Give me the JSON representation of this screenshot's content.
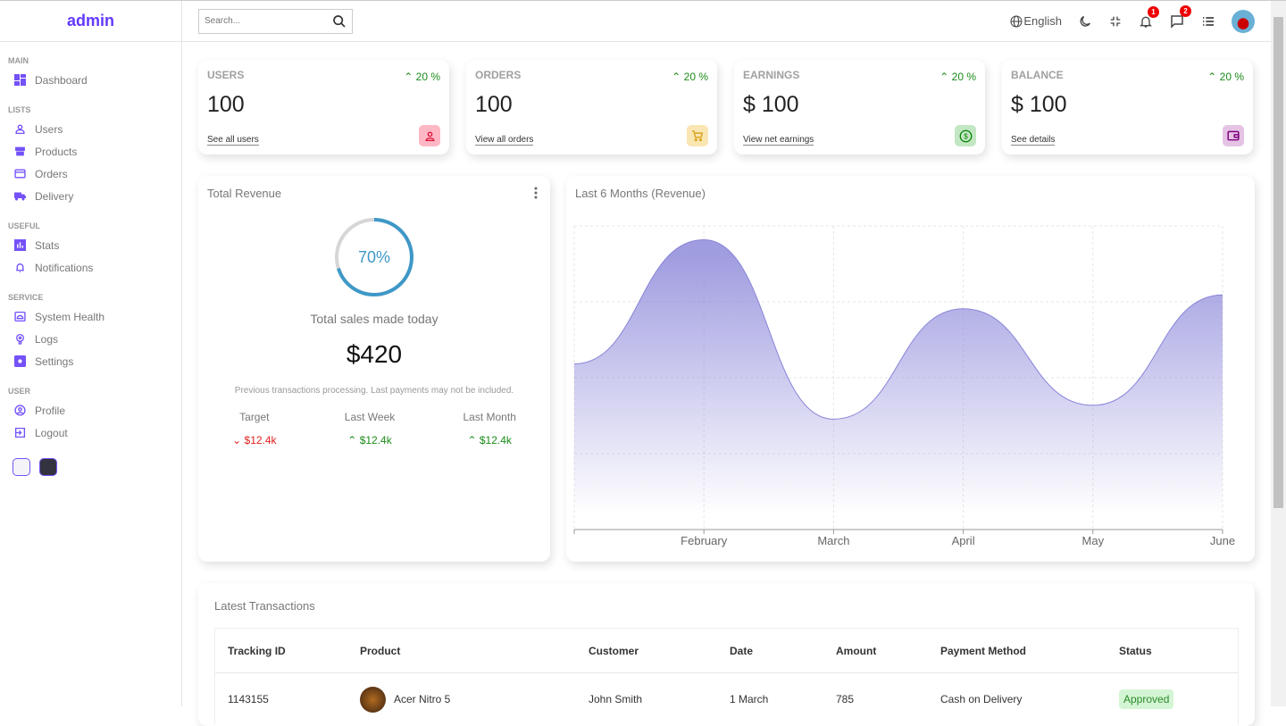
{
  "sidebar": {
    "logo": "admin",
    "sections": [
      {
        "title": "MAIN",
        "items": [
          {
            "label": "Dashboard",
            "icon": "dashboard-icon"
          }
        ]
      },
      {
        "title": "LISTS",
        "items": [
          {
            "label": "Users",
            "icon": "user-icon"
          },
          {
            "label": "Products",
            "icon": "store-icon"
          },
          {
            "label": "Orders",
            "icon": "credit-card-icon"
          },
          {
            "label": "Delivery",
            "icon": "truck-icon"
          }
        ]
      },
      {
        "title": "USEFUL",
        "items": [
          {
            "label": "Stats",
            "icon": "chart-icon"
          },
          {
            "label": "Notifications",
            "icon": "bell-icon"
          }
        ]
      },
      {
        "title": "SERVICE",
        "items": [
          {
            "label": "System Health",
            "icon": "health-icon"
          },
          {
            "label": "Logs",
            "icon": "brain-icon"
          },
          {
            "label": "Settings",
            "icon": "settings-icon"
          }
        ]
      },
      {
        "title": "USER",
        "items": [
          {
            "label": "Profile",
            "icon": "profile-icon"
          },
          {
            "label": "Logout",
            "icon": "logout-icon"
          }
        ]
      }
    ],
    "themes": {
      "light": "#f4f4f8",
      "dark": "#333340"
    }
  },
  "topbar": {
    "search_placeholder": "Search...",
    "language": "English",
    "notifications": "1",
    "messages": "2"
  },
  "widgets": [
    {
      "title": "USERS",
      "percent": "20 %",
      "value": "100",
      "link": "See all users",
      "icon": "person-icon",
      "color": "#dc143c",
      "bg": "#ffb7c5"
    },
    {
      "title": "ORDERS",
      "percent": "20 %",
      "value": "100",
      "link": "View all orders",
      "icon": "cart-icon",
      "color": "#daa520",
      "bg": "#fae6b3"
    },
    {
      "title": "EARNINGS",
      "percent": "20 %",
      "value": "$ 100",
      "link": "View net earnings",
      "icon": "dollar-icon",
      "color": "#008000",
      "bg": "#c3e6c3"
    },
    {
      "title": "BALANCE",
      "percent": "20 %",
      "value": "$ 100",
      "link": "See details",
      "icon": "wallet-icon",
      "color": "#800080",
      "bg": "#e5c3e5"
    }
  ],
  "featured": {
    "title": "Total Revenue",
    "progress": 70,
    "progress_label": "70%",
    "subtitle": "Total sales made today",
    "amount": "$420",
    "note": "Previous transactions processing. Last payments may not be included.",
    "summary": [
      {
        "label": "Target",
        "value": "$12.4k",
        "trend": "down"
      },
      {
        "label": "Last Week",
        "value": "$12.4k",
        "trend": "up"
      },
      {
        "label": "Last Month",
        "value": "$12.4k",
        "trend": "up"
      }
    ]
  },
  "chart_data": {
    "type": "area",
    "title": "Last 6 Months (Revenue)",
    "categories": [
      "",
      "February",
      "March",
      "April",
      "May",
      "June"
    ],
    "values": [
      1200,
      2100,
      800,
      1600,
      900,
      1700
    ],
    "ylim": [
      0,
      2200
    ],
    "grid": true,
    "color": "#8884d8"
  },
  "transactions": {
    "title": "Latest Transactions",
    "headers": [
      "Tracking ID",
      "Product",
      "Customer",
      "Date",
      "Amount",
      "Payment Method",
      "Status"
    ],
    "rows": [
      {
        "id": "1143155",
        "product": "Acer Nitro 5",
        "customer": "John Smith",
        "date": "1 March",
        "amount": "785",
        "method": "Cash on Delivery",
        "status": "Approved"
      }
    ]
  }
}
